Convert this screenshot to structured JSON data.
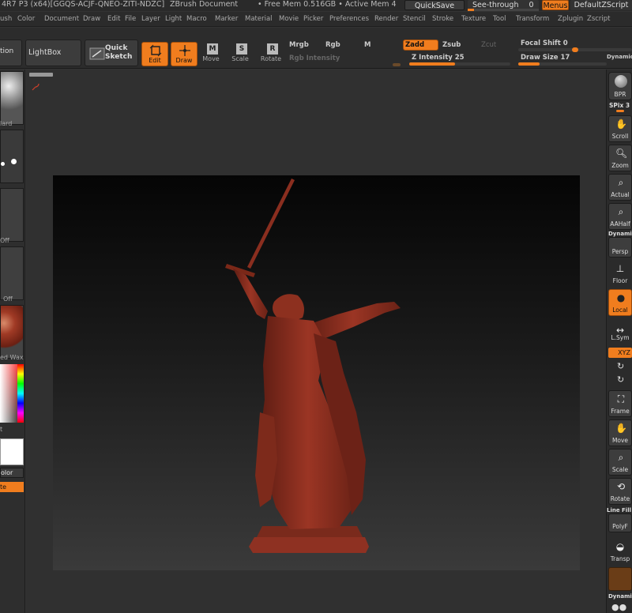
{
  "titlebar": {
    "title": "4R7 P3 (x64)[GGQS-ACJF-QNEO-ZITI-NDZC]",
    "document": "ZBrush Document",
    "memory": "• Free Mem 0.516GB • Active Mem 4",
    "quicksave": "QuickSave",
    "see_through_label": "See-through",
    "see_through_value": "0",
    "menus": "Menus",
    "script": "DefaultZScript"
  },
  "menus": [
    "ush",
    "Color",
    "Document",
    "Draw",
    "Edit",
    "File",
    "Layer",
    "Light",
    "Macro",
    "Marker",
    "Material",
    "Movie",
    "Picker",
    "Preferences",
    "Render",
    "Stencil",
    "Stroke",
    "Texture",
    "Tool",
    "Transform",
    "Zplugin",
    "Zscript"
  ],
  "shelf": {
    "tion": "tion",
    "lightbox": "LightBox",
    "quick_sketch_1": "Quick",
    "quick_sketch_2": "Sketch",
    "edit": "Edit",
    "draw": "Draw",
    "move": "Move",
    "scale": "Scale",
    "rotate": "Rotate",
    "mrgb": "Mrgb",
    "rgb": "Rgb",
    "m": "M",
    "rgb_intensity": "Rgb Intensity",
    "zadd": "Zadd",
    "zsub": "Zsub",
    "zcut": "Zcut",
    "z_intensity": "Z Intensity 25",
    "focal_shift": "Focal Shift 0",
    "draw_size": "Draw Size 17",
    "dynamic": "Dynamic"
  },
  "left": {
    "tile1_caption": "lard",
    "tile3_caption": "Off",
    "tile4_caption": "Off",
    "tile5_caption": "ed  Wax",
    "color_caption": "t",
    "color_btn": "olor",
    "alternate_btn": "te"
  },
  "right": {
    "bpr": "BPR",
    "spix": "SPix 3",
    "scroll": "Scroll",
    "zoom": "Zoom",
    "actual": "Actual",
    "aahalf": "AAHalf",
    "dynamic": "Dynamic",
    "persp": "Persp",
    "floor": "Floor",
    "local": "Local",
    "lsym": "L.Sym",
    "xyz": "XYZ",
    "frame": "Frame",
    "move": "Move",
    "scale": "Scale",
    "rotate": "Rotate",
    "line_fill": "Line Fill",
    "polyf": "PolyF",
    "transp": "Transp",
    "dynamic2": "Dynamic"
  },
  "colors": {
    "accent": "#f07d1e",
    "sculpt": "#8a2d1f"
  }
}
